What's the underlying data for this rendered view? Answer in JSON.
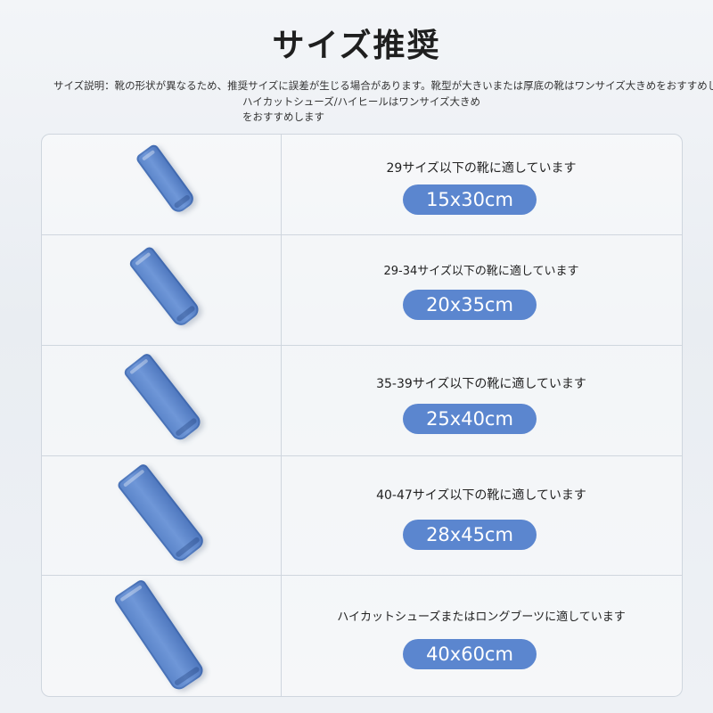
{
  "title": "サイズ推奨",
  "description": {
    "line1": "サイズ説明：靴の形状が異なるため、推奨サイズに誤差が生じる場合があります。靴型が大きいまたは厚底の靴はワンサイズ大きめをおすすめします",
    "line2": "ハイカットシューズ/ハイヒールはワンサイズ大きめ",
    "line3": "をおすすめします"
  },
  "rows": [
    {
      "suitable": "29サイズ以下の靴に適しています",
      "size": "15x30cm",
      "icon": "blue-bag-icon"
    },
    {
      "suitable": "29-34サイズ以下の靴に適しています",
      "size": "20x35cm",
      "icon": "blue-bag-icon"
    },
    {
      "suitable": "35-39サイズ以下の靴に適しています",
      "size": "25x40cm",
      "icon": "blue-bag-icon"
    },
    {
      "suitable": "40-47サイズ以下の靴に適しています",
      "size": "28x45cm",
      "icon": "blue-bag-icon"
    },
    {
      "suitable": "ハイカットシューズまたはロングブーツに適しています",
      "size": "40x60cm",
      "icon": "blue-bag-icon"
    }
  ],
  "colors": {
    "accent": "#5b86cf",
    "border": "#cfd6de"
  }
}
